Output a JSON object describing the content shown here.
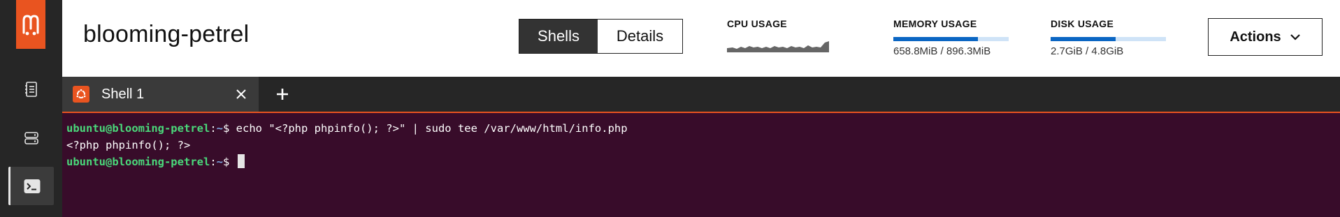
{
  "app": {
    "logo_letter": "m",
    "accent": "#e95420"
  },
  "sidebar": {
    "items": [
      {
        "name": "instances",
        "icon": "notebook-icon"
      },
      {
        "name": "servers",
        "icon": "server-icon"
      },
      {
        "name": "shell",
        "icon": "terminal-icon",
        "active": true
      }
    ]
  },
  "header": {
    "instance_name": "blooming-petrel",
    "tabs": [
      {
        "label": "Shells",
        "active": true
      },
      {
        "label": "Details",
        "active": false
      }
    ],
    "metrics": {
      "cpu": {
        "label": "CPU USAGE"
      },
      "memory": {
        "label": "MEMORY USAGE",
        "value": "658.8MiB / 896.3MiB",
        "fraction": 0.735
      },
      "disk": {
        "label": "DISK USAGE",
        "value": "2.7GiB / 4.8GiB",
        "fraction": 0.5625
      }
    },
    "actions_label": "Actions"
  },
  "tabbar": {
    "tab_label": "Shell 1"
  },
  "terminal": {
    "lines": [
      {
        "user": "ubuntu@blooming-petrel",
        "sep": ":",
        "path": "~",
        "sym": "$ ",
        "cmd": "echo \"<?php phpinfo(); ?>\" | sudo tee /var/www/html/info.php"
      },
      {
        "output": "<?php phpinfo(); ?>"
      },
      {
        "user": "ubuntu@blooming-petrel",
        "sep": ":",
        "path": "~",
        "sym": "$ ",
        "cmd": ""
      }
    ]
  }
}
